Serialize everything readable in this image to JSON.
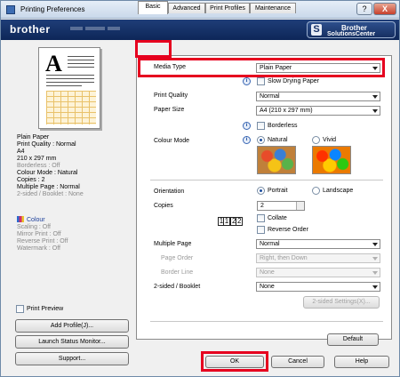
{
  "window": {
    "title": "Printing Preferences",
    "help_glyph": "?",
    "close_glyph": "X"
  },
  "banner": {
    "logo": "brother",
    "sc_letter": "S",
    "sc_line1": "Brother",
    "sc_line2": "SolutionsCenter"
  },
  "preview": {
    "glyph": "A"
  },
  "summary": {
    "media": "Plain Paper",
    "quality": "Print Quality : Normal",
    "size": "A4",
    "dims": "210 x 297 mm",
    "borderless": "Borderless : Off",
    "colour_mode": "Colour Mode : Natural",
    "copies": "Copies : 2",
    "multipage": "Multiple Page : Normal",
    "twosided": "2-sided / Booklet : None",
    "colour": "Colour",
    "scaling": "Scaling : Off",
    "mirror": "Mirror Print : Off",
    "reverse": "Reverse Print : Off",
    "watermark": "Watermark : Off"
  },
  "left": {
    "print_preview": "Print Preview",
    "add_profile": "Add Profile(J)...",
    "launch_status": "Launch Status Monitor...",
    "support": "Support..."
  },
  "tabs": [
    "Basic",
    "Advanced",
    "Print Profiles",
    "Maintenance"
  ],
  "basic": {
    "media_type_label": "Media Type",
    "media_type_value": "Plain Paper",
    "slow_drying": "Slow Drying Paper",
    "quality_label": "Print Quality",
    "quality_value": "Normal",
    "size_label": "Paper Size",
    "size_value": "A4 (210 x 297 mm)",
    "borderless": "Borderless",
    "colour_mode_label": "Colour Mode",
    "natural": "Natural",
    "vivid": "Vivid",
    "orientation_label": "Orientation",
    "portrait": "Portrait",
    "landscape": "Landscape",
    "copies_label": "Copies",
    "copies_value": "2",
    "collate": "Collate",
    "reverse_order": "Reverse Order",
    "multipage_label": "Multiple Page",
    "multipage_value": "Normal",
    "page_order_label": "Page Order",
    "page_order_value": "Right, then Down",
    "border_line_label": "Border Line",
    "border_line_value": "None",
    "twosided_label": "2-sided / Booklet",
    "twosided_value": "None",
    "twosided_settings": "2-sided Settings(X)...",
    "default": "Default"
  },
  "footer": {
    "ok": "OK",
    "cancel": "Cancel",
    "help": "Help"
  }
}
